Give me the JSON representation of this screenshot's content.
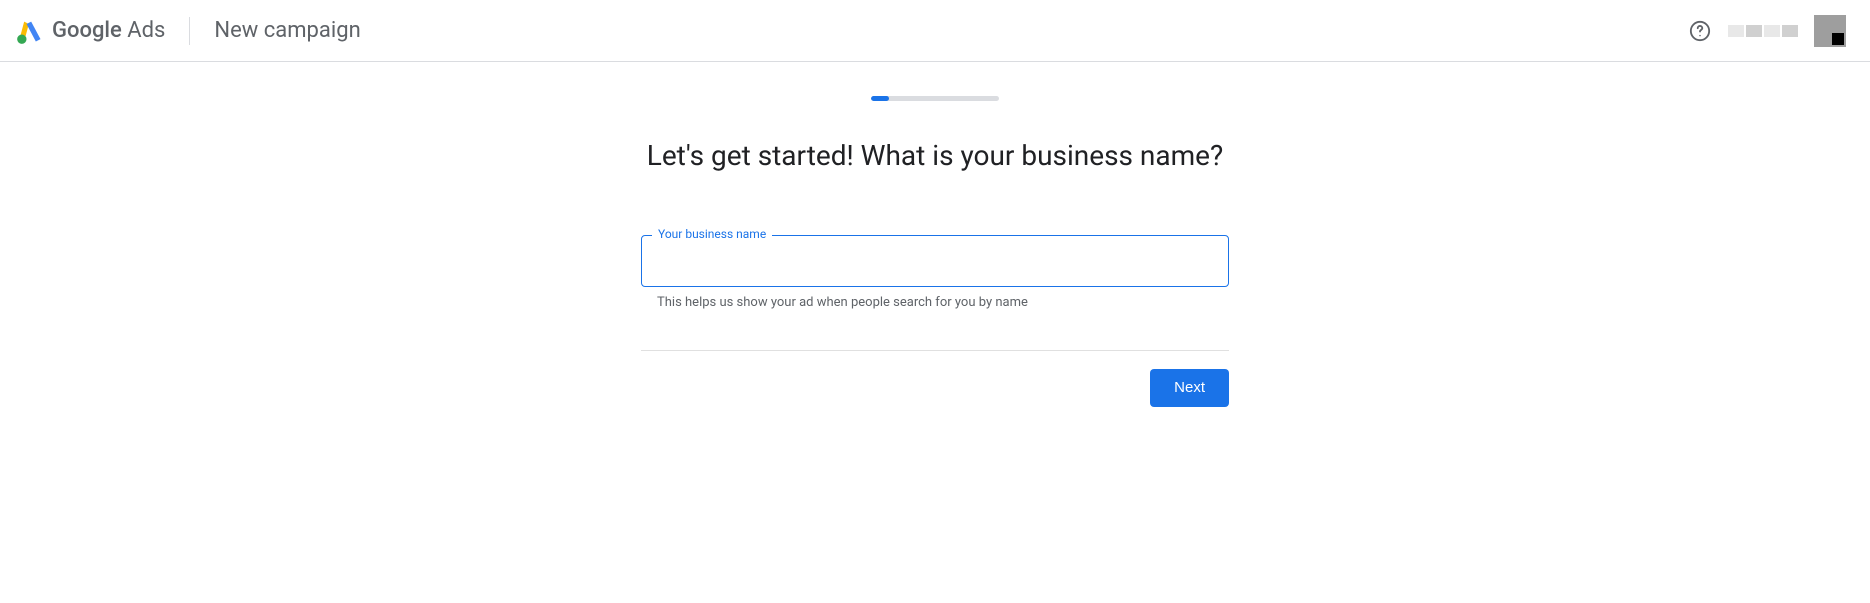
{
  "header": {
    "brand_bold": "Google",
    "brand_light": "Ads",
    "page_subtitle": "New campaign"
  },
  "progress": {
    "percent": 14
  },
  "main": {
    "headline": "Let's get started! What is your business name?"
  },
  "form": {
    "business_name_label": "Your business name",
    "business_name_value": "",
    "helper_text": "This helps us show your ad when people search for you by name"
  },
  "actions": {
    "next_label": "Next"
  }
}
